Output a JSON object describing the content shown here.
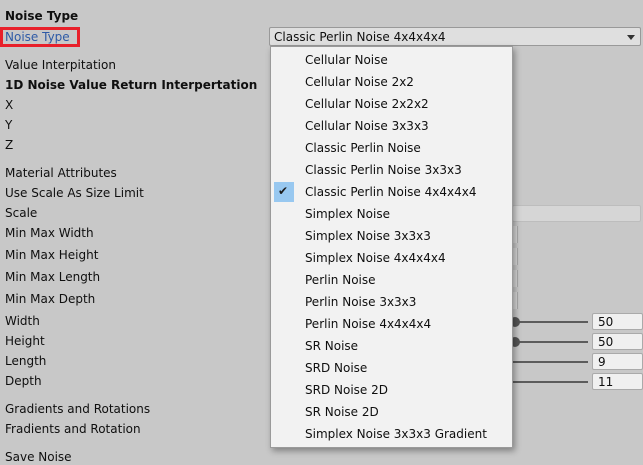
{
  "panel": {
    "header": "Noise Type",
    "noise_type_label": "Noise Type",
    "labels": {
      "value_interpitation": "Value Interpitation",
      "return_interpertation": "1D Noise Value Return Interpertation",
      "x": "X",
      "y": "Y",
      "z": "Z",
      "material_attributes": "Material Attributes",
      "use_scale": "Use Scale As Size Limit",
      "scale": "Scale",
      "min_max_width": "Min Max Width",
      "min_max_height": "Min Max Height",
      "min_max_length": "Min Max Length",
      "min_max_depth": "Min Max Depth",
      "width": "Width",
      "height": "Height",
      "length": "Length",
      "depth": "Depth",
      "gradients": "Gradients and Rotations",
      "fradients": "Fradients and Rotation",
      "save_noise": "Save Noise"
    },
    "values": {
      "width": "50",
      "height": "50",
      "length": "9",
      "depth": "11"
    }
  },
  "dropdown": {
    "selected": "Classic Perlin Noise 4x4x4x4",
    "options": [
      "Cellular Noise",
      "Cellular Noise 2x2",
      "Cellular Noise 2x2x2",
      "Cellular Noise 3x3x3",
      "Classic Perlin Noise",
      "Classic Perlin Noise 3x3x3",
      "Classic Perlin Noise 4x4x4x4",
      "Simplex Noise",
      "Simplex Noise 3x3x3",
      "Simplex Noise 4x4x4x4",
      "Perlin Noise",
      "Perlin Noise 3x3x3",
      "Perlin Noise 4x4x4x4",
      "SR Noise",
      "SRD Noise",
      "SRD Noise 2D",
      "SR Noise 2D",
      "Simplex Noise 3x3x3 Gradient"
    ],
    "selected_index": 6,
    "check_glyph": "✔"
  },
  "colors": {
    "highlight_border": "#e8202a",
    "selected_bg": "#98c8f0",
    "panel_bg": "#c8c8c8"
  }
}
